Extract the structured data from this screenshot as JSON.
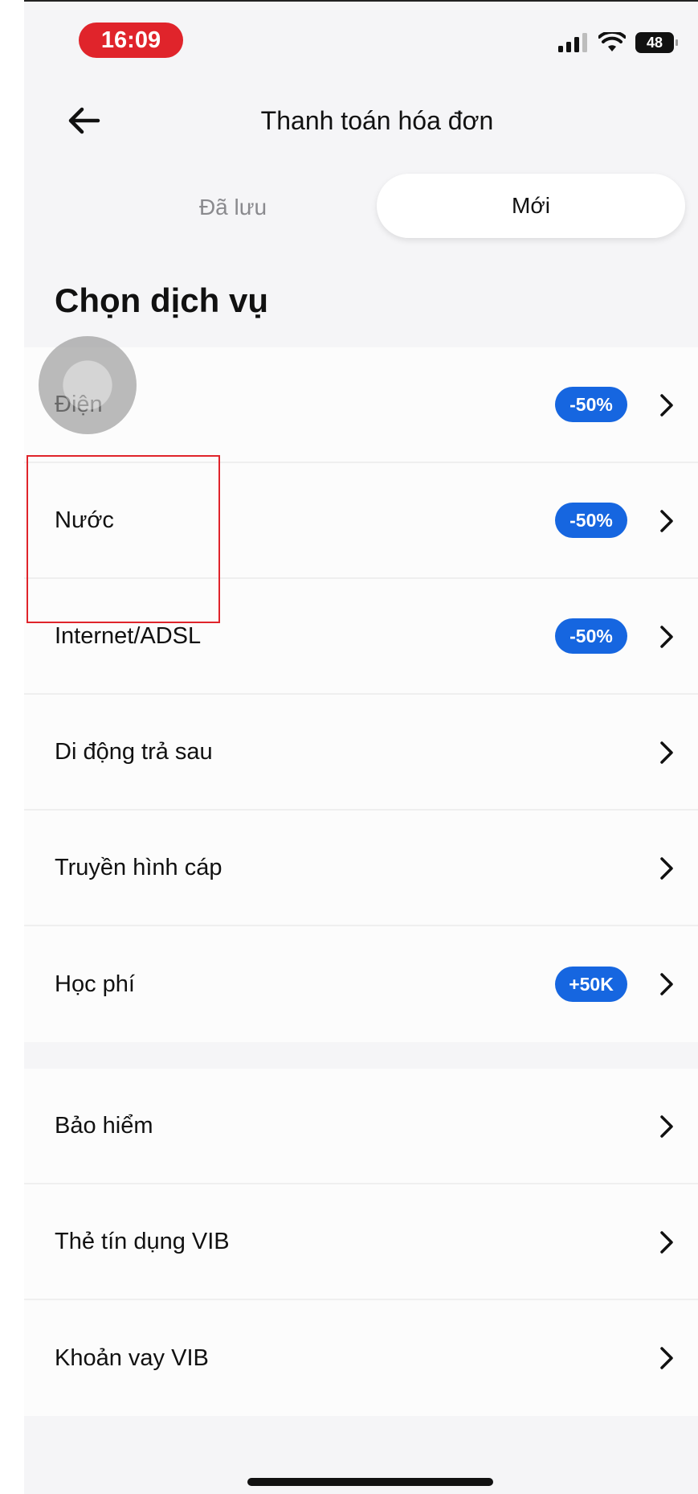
{
  "status_bar": {
    "time": "16:09",
    "battery": "48"
  },
  "header": {
    "title": "Thanh toán hóa đơn"
  },
  "tabs": {
    "saved": "Đã lưu",
    "new": "Mới",
    "active": "new"
  },
  "section_title": "Chọn dịch vụ",
  "services_group1": [
    {
      "label": "Điện",
      "badge": "-50%"
    },
    {
      "label": "Nước",
      "badge": "-50%"
    },
    {
      "label": "Internet/ADSL",
      "badge": "-50%"
    },
    {
      "label": "Di động trả sau",
      "badge": ""
    },
    {
      "label": "Truyền hình cáp",
      "badge": ""
    },
    {
      "label": "Học phí",
      "badge": "+50K"
    }
  ],
  "services_group2": [
    {
      "label": "Bảo hiểm"
    },
    {
      "label": "Thẻ tín dụng VIB"
    },
    {
      "label": "Khoản vay VIB"
    }
  ],
  "colors": {
    "accent_badge": "#1666e0",
    "time_pill": "#e0242b",
    "highlight": "#e0242b"
  }
}
